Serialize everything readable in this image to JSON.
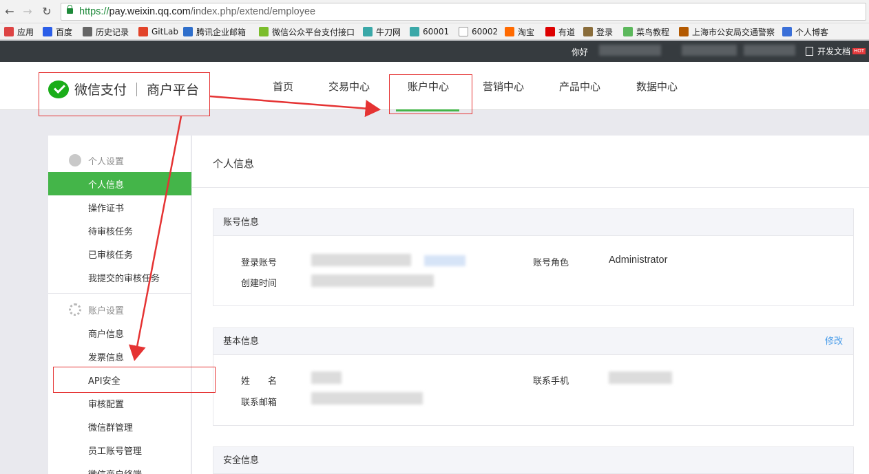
{
  "browser": {
    "url_secure": "https://",
    "url_host": "pay.weixin.qq.com",
    "url_path": "/index.php/extend/employee",
    "bookmarks": [
      {
        "label": "应用",
        "icon": "apps-grid-icon",
        "color": "#d44"
      },
      {
        "label": "百度",
        "icon": "baidu-icon",
        "color": "#2b5ee8"
      },
      {
        "label": "历史记录",
        "icon": "history-icon",
        "color": "#666"
      },
      {
        "label": "GitLab",
        "icon": "gitlab-icon",
        "color": "#e24329"
      },
      {
        "label": "腾讯企业邮箱",
        "icon": "mail-icon",
        "color": "#2f6fcb"
      },
      {
        "label": "微信公众平台支付接口",
        "icon": "wechat-icon",
        "color": "#7bbd2b"
      },
      {
        "label": "牛刀网",
        "icon": "n-icon",
        "color": "#3aa8a8"
      },
      {
        "label": "60001",
        "icon": "n-icon",
        "color": "#3aa8a8"
      },
      {
        "label": "60002",
        "icon": "page-icon",
        "color": "#ffffff"
      },
      {
        "label": "淘宝",
        "icon": "taobao-icon",
        "color": "#ff6a00"
      },
      {
        "label": "有道",
        "icon": "youdao-icon",
        "color": "#d00"
      },
      {
        "label": "登录",
        "icon": "image-icon",
        "color": "#8a6d3b"
      },
      {
        "label": "菜鸟教程",
        "icon": "runoob-icon",
        "color": "#5cb85c"
      },
      {
        "label": "上海市公安局交通警察",
        "icon": "police-icon",
        "color": "#b35900"
      },
      {
        "label": "个人博客",
        "icon": "blog-icon",
        "color": "#3a6fd8"
      }
    ]
  },
  "topbar": {
    "greeting": "你好",
    "dev_docs": "开发文档",
    "badge": "HOT"
  },
  "header": {
    "logo_text": "微信支付",
    "platform_text": "商户平台",
    "nav": [
      "首页",
      "交易中心",
      "账户中心",
      "营销中心",
      "产品中心",
      "数据中心"
    ],
    "active_nav": "账户中心"
  },
  "sidebar": {
    "section1": "个人设置",
    "items1": [
      "个人信息",
      "操作证书",
      "待审核任务",
      "已审核任务",
      "我提交的审核任务"
    ],
    "section2": "账户设置",
    "items2": [
      "商户信息",
      "发票信息",
      "API安全",
      "审核配置",
      "微信群管理",
      "员工账号管理",
      "微信商户终端"
    ]
  },
  "main": {
    "title": "个人信息",
    "account_card": {
      "title": "账号信息",
      "login_label": "登录账号",
      "created_label": "创建时间",
      "role_label": "账号角色",
      "role_value": "Administrator"
    },
    "basic_card": {
      "title": "基本信息",
      "edit": "修改",
      "name_label": "姓　　名",
      "email_label": "联系邮箱",
      "phone_label": "联系手机"
    },
    "security_card": {
      "title": "安全信息"
    }
  }
}
